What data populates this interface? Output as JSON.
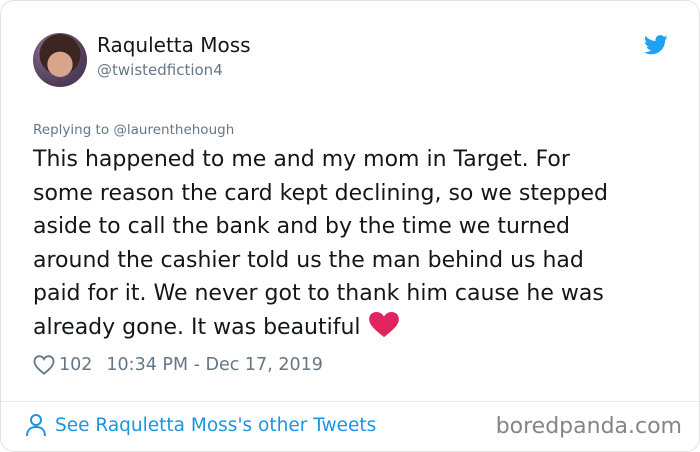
{
  "author": {
    "name": "Raquletta Moss",
    "handle": "@twistedfiction4"
  },
  "reply_to": "Replying to @laurenthehough",
  "tweet_lines": [
    "This happened to me and my mom in Target. For",
    "some reason the card kept declining, so we stepped",
    "aside to call the bank and by the time we turned",
    "around the cashier told us the man behind us had",
    "paid for it. We never got to thank him cause he was",
    "already gone. It was beautiful"
  ],
  "emoji": "red-heart",
  "likes": "102",
  "timestamp": "10:34 PM - Dec 17, 2019",
  "footer": {
    "link_text": "See Raquletta Moss's other Tweets"
  },
  "watermark": "boredpanda.com",
  "colors": {
    "text": "#14171a",
    "secondary": "#657786",
    "link": "#1b95e0",
    "twitter_blue": "#1da1f2",
    "heart": "#e0245e"
  },
  "icons": [
    "twitter-bird-icon",
    "like-heart-icon",
    "person-icon",
    "red-heart-emoji"
  ]
}
